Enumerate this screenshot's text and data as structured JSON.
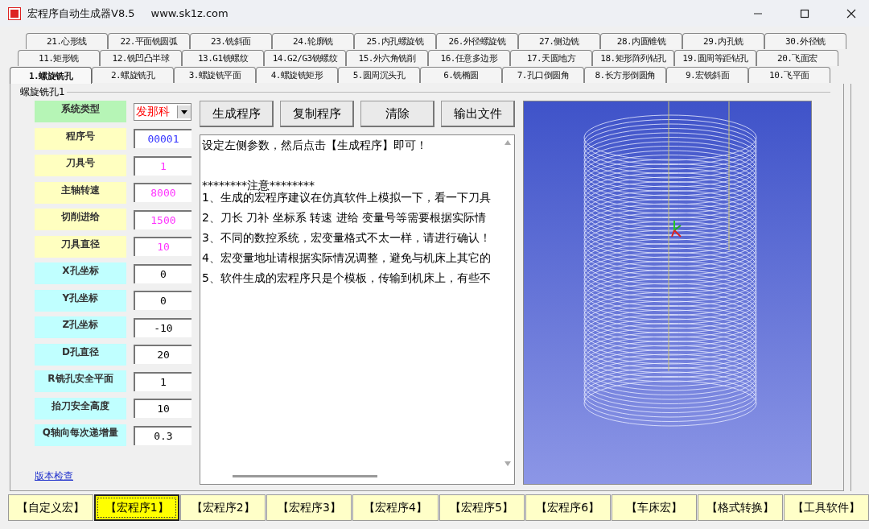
{
  "window": {
    "title": "宏程序自动生成器V8.5",
    "url": "www.sk1z.com"
  },
  "tab_rows": [
    [
      {
        "label": "21.心形线",
        "selected": false
      },
      {
        "label": "22.平面铣圆弧",
        "selected": false
      },
      {
        "label": "23.铣斜面",
        "selected": false
      },
      {
        "label": "24.轮廓铣",
        "selected": false
      },
      {
        "label": "25.内孔螺旋铣",
        "selected": false
      },
      {
        "label": "26.外径螺旋铣",
        "selected": false
      },
      {
        "label": "27.侧边铣",
        "selected": false
      },
      {
        "label": "28.内圆锥铣",
        "selected": false
      },
      {
        "label": "29.内孔铣",
        "selected": false
      },
      {
        "label": "30.外径铣",
        "selected": false
      }
    ],
    [
      {
        "label": "11.矩形铣",
        "selected": false
      },
      {
        "label": "12.铣凹凸半球",
        "selected": false
      },
      {
        "label": "13.G1铣螺纹",
        "selected": false
      },
      {
        "label": "14.G2/G3铣螺纹",
        "selected": false
      },
      {
        "label": "15.外六角铣削",
        "selected": false
      },
      {
        "label": "16.任意多边形",
        "selected": false
      },
      {
        "label": "17.天圆地方",
        "selected": false
      },
      {
        "label": "18.矩形阵列钻孔",
        "selected": false
      },
      {
        "label": "19.圆周等距钻孔",
        "selected": false
      },
      {
        "label": "20.飞面宏",
        "selected": false
      }
    ],
    [
      {
        "label": "1.螺旋铣孔",
        "selected": true
      },
      {
        "label": "2.螺旋铣孔",
        "selected": false
      },
      {
        "label": "3.螺旋铣平面",
        "selected": false
      },
      {
        "label": "4.螺旋铣矩形",
        "selected": false
      },
      {
        "label": "5.圆周沉头孔",
        "selected": false
      },
      {
        "label": "6.铣椭圆",
        "selected": false
      },
      {
        "label": "7.孔口倒圆角",
        "selected": false
      },
      {
        "label": "8.长方形倒圆角",
        "selected": false
      },
      {
        "label": "9.宏铣斜面",
        "selected": false
      },
      {
        "label": "10.飞平面",
        "selected": false
      }
    ]
  ],
  "group_title": "螺旋铣孔1",
  "params": [
    {
      "label": "系统类型",
      "color": "#b6f5b6",
      "field": {
        "kind": "select",
        "value": "发那科",
        "color": "#ff0000"
      }
    },
    {
      "label": "程序号",
      "color": "#ffffc0",
      "field": {
        "kind": "input",
        "value": "00001",
        "color": "#3333ff"
      }
    },
    {
      "label": "刀具号",
      "color": "#ffffc0",
      "field": {
        "kind": "input",
        "value": "1",
        "color": "#ff33ff"
      }
    },
    {
      "label": "主轴转速",
      "color": "#ffffc0",
      "field": {
        "kind": "input",
        "value": "8000",
        "color": "#ff33ff"
      }
    },
    {
      "label": "切削进给",
      "color": "#ffffc0",
      "field": {
        "kind": "input",
        "value": "1500",
        "color": "#ff33ff"
      }
    },
    {
      "label": "刀具直径",
      "color": "#ffffc0",
      "field": {
        "kind": "input",
        "value": "10",
        "color": "#ff33ff"
      }
    },
    {
      "label": "X孔坐标",
      "color": "#c0ffff",
      "field": {
        "kind": "input",
        "value": "0",
        "color": "#000000"
      }
    },
    {
      "label": "Y孔坐标",
      "color": "#c0ffff",
      "field": {
        "kind": "input",
        "value": "0",
        "color": "#000000"
      }
    },
    {
      "label": "Z孔坐标",
      "color": "#c0ffff",
      "field": {
        "kind": "input",
        "value": "-10",
        "color": "#000000"
      }
    },
    {
      "label": "D孔直径",
      "color": "#c0ffff",
      "field": {
        "kind": "input",
        "value": "20",
        "color": "#000000"
      }
    },
    {
      "label": "R铣孔安全平面",
      "color": "#c0ffff",
      "field": {
        "kind": "input",
        "value": "1",
        "color": "#000000"
      }
    },
    {
      "label": "抬刀安全高度",
      "color": "#c0ffff",
      "field": {
        "kind": "input",
        "value": "10",
        "color": "#000000"
      }
    },
    {
      "label": "Q轴向每次递增量",
      "color": "#c0ffff",
      "field": {
        "kind": "input",
        "value": "0.3",
        "color": "#000000"
      }
    }
  ],
  "version_link": "版本检查",
  "actions": [
    "生成程序",
    "复制程序",
    "清除",
    "输出文件"
  ],
  "output_lines": [
    "设定左侧参数，然后点击【生成程序】即可！",
    "********注意********",
    "1、生成的宏程序建议在仿真软件上模拟一下，看一下刀具",
    "2、刀长 刀补 坐标系 转速 进给 变量号等需要根据实际情",
    "3、不同的数控系统，宏变量格式不太一样，请进行确认！",
    "4、宏变量地址请根据实际情况调整，避免与机床上其它的",
    "5、软件生成的宏程序只是个模板，传输到机床上，有些不"
  ],
  "bottom_buttons": [
    {
      "label": "【自定义宏】",
      "selected": false
    },
    {
      "label": "【宏程序1】",
      "selected": true
    },
    {
      "label": "【宏程序2】",
      "selected": false
    },
    {
      "label": "【宏程序3】",
      "selected": false
    },
    {
      "label": "【宏程序4】",
      "selected": false
    },
    {
      "label": "【宏程序5】",
      "selected": false
    },
    {
      "label": "【宏程序6】",
      "selected": false
    },
    {
      "label": "【车床宏】",
      "selected": false
    },
    {
      "label": "【格式转换】",
      "selected": false
    },
    {
      "label": "【工具软件】",
      "selected": false
    }
  ]
}
